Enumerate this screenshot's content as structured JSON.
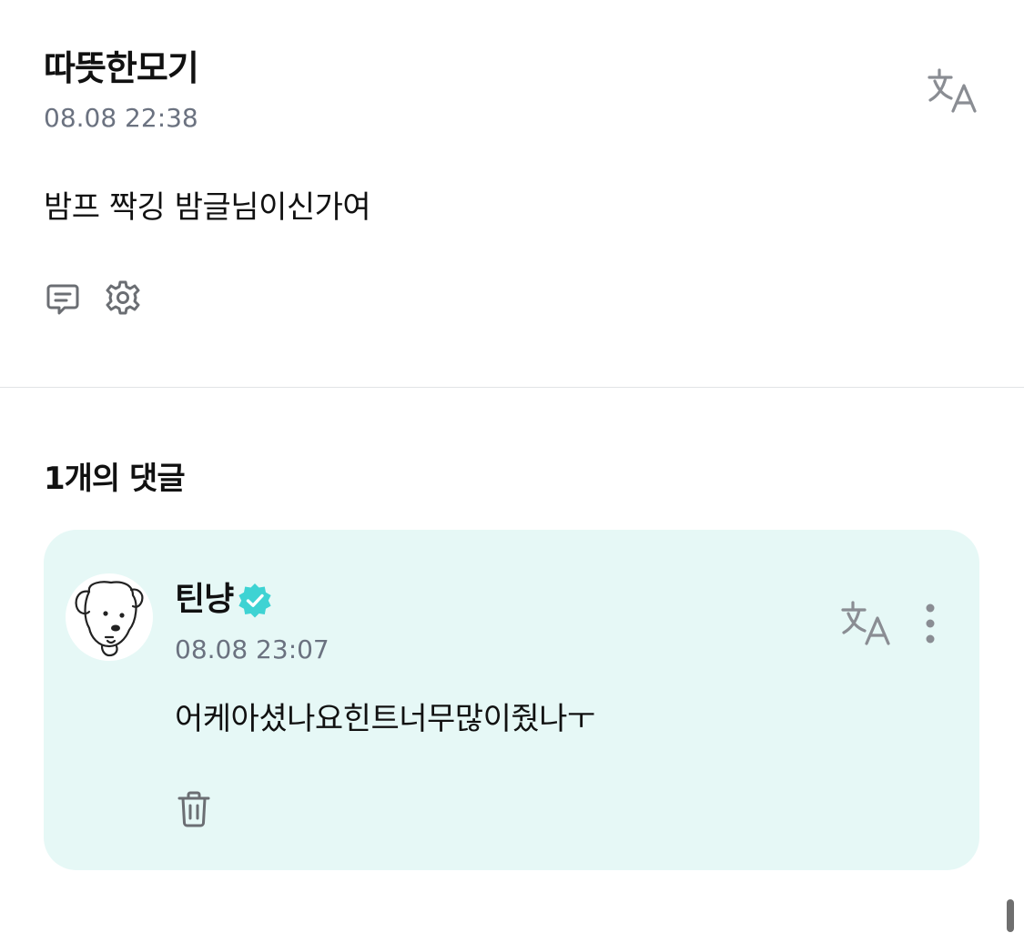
{
  "post": {
    "author": "따뜻한모기",
    "time": "08.08 22:38",
    "body": "밤프 짝깅 밤글님이신가여",
    "translate_icon": "translate-icon",
    "comment_icon": "comment-icon",
    "settings_icon": "gear-icon"
  },
  "comments": {
    "heading": "1개의 댓글",
    "items": [
      {
        "author": "틴냥",
        "verified": true,
        "time": "08.08 23:07",
        "body": "어케아셨나요힌트너무많이줬나ㅜ",
        "avatar_icon": "dog-avatar",
        "translate_icon": "translate-icon",
        "more_icon": "more-vertical-icon",
        "delete_icon": "trash-icon"
      }
    ]
  },
  "colors": {
    "card_background": "#e6f8f6",
    "verified_badge": "#3ed3d3",
    "muted_text": "#6b7280",
    "icon_gray": "#8a8d93",
    "divider": "#e1e3e6"
  }
}
